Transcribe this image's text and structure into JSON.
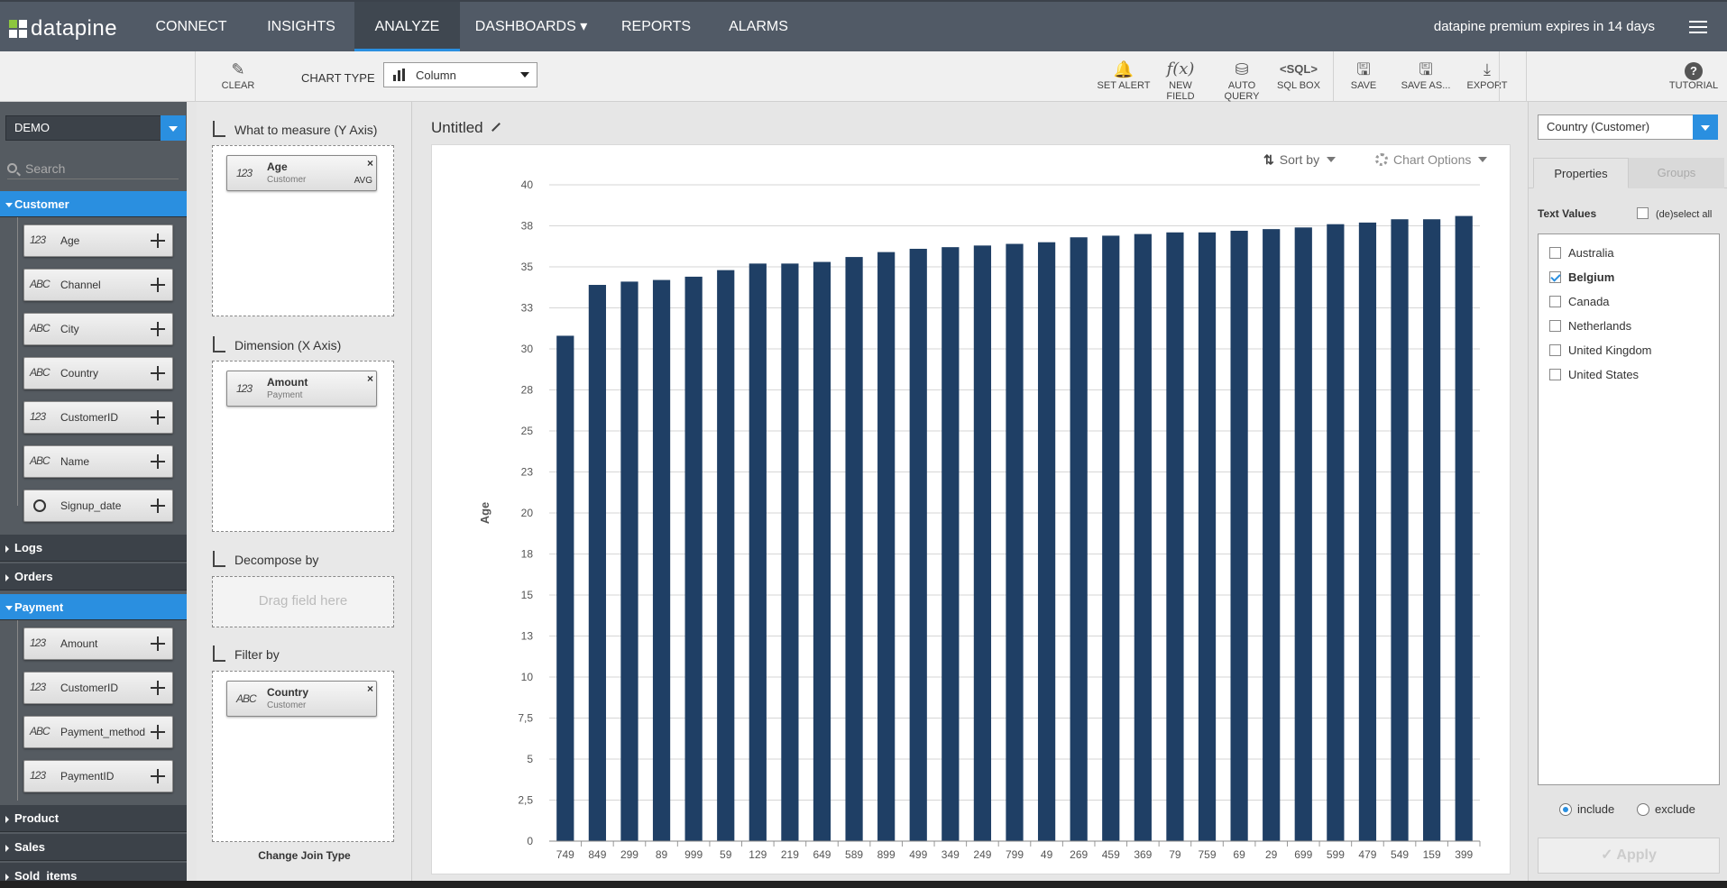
{
  "brand": {
    "name": "datapine"
  },
  "nav": {
    "items": [
      {
        "label": "CONNECT"
      },
      {
        "label": "INSIGHTS"
      },
      {
        "label": "ANALYZE"
      },
      {
        "label": "DASHBOARDS ▾"
      },
      {
        "label": "REPORTS"
      },
      {
        "label": "ALARMS"
      }
    ],
    "active": "ANALYZE",
    "premium_notice": "datapine premium expires in 14 days"
  },
  "toolbar": {
    "clear": "CLEAR",
    "chart_type_label": "CHART TYPE",
    "chart_type_value": "Column",
    "set_alert": "SET ALERT",
    "new_field": "NEW FIELD",
    "auto_query": "AUTO QUERY",
    "sql_box": "SQL BOX",
    "sql_icon_text": "<SQL>",
    "fx_icon_text": "f(x)",
    "save": "SAVE",
    "save_as": "SAVE AS...",
    "export": "EXPORT",
    "tutorial": "TUTORIAL",
    "help_icon_text": "?"
  },
  "sidebar": {
    "datasource": "DEMO",
    "search_placeholder": "Search",
    "tables": [
      {
        "name": "Customer",
        "open": true,
        "fields": [
          {
            "type": "123",
            "name": "Age"
          },
          {
            "type": "ABC",
            "name": "Channel"
          },
          {
            "type": "ABC",
            "name": "City"
          },
          {
            "type": "ABC",
            "name": "Country"
          },
          {
            "type": "123",
            "name": "CustomerID"
          },
          {
            "type": "ABC",
            "name": "Name"
          },
          {
            "type": "date",
            "name": "Signup_date"
          }
        ]
      },
      {
        "name": "Logs",
        "open": false
      },
      {
        "name": "Orders",
        "open": false
      },
      {
        "name": "Payment",
        "open": true,
        "fields": [
          {
            "type": "123",
            "name": "Amount"
          },
          {
            "type": "123",
            "name": "CustomerID"
          },
          {
            "type": "ABC",
            "name": "Payment_method"
          },
          {
            "type": "123",
            "name": "PaymentID"
          }
        ]
      },
      {
        "name": "Product",
        "open": false
      },
      {
        "name": "Sales",
        "open": false
      },
      {
        "name": "Sold_items",
        "open": false
      }
    ]
  },
  "config": {
    "measure_title": "What to measure (Y Axis)",
    "measure_chip": {
      "type": "123",
      "name": "Age",
      "table": "Customer",
      "agg": "AVG"
    },
    "dimension_title": "Dimension (X Axis)",
    "dimension_chip": {
      "type": "123",
      "name": "Amount",
      "table": "Payment"
    },
    "decompose_title": "Decompose by",
    "decompose_hint": "Drag field here",
    "filter_title": "Filter by",
    "filter_chip": {
      "type": "ABC",
      "name": "Country",
      "table": "Customer"
    },
    "join_label": "Change Join Type"
  },
  "chart": {
    "title": "Untitled",
    "sort_label": "Sort by",
    "options_label": "Chart Options"
  },
  "chart_data": {
    "type": "bar",
    "ylabel": "Age",
    "xlabel": "",
    "ylim": [
      0,
      40
    ],
    "yticks": [
      "0",
      "2,5",
      "5",
      "7,5",
      "10",
      "13",
      "15",
      "18",
      "20",
      "23",
      "25",
      "28",
      "30",
      "33",
      "35",
      "38",
      "40"
    ],
    "grid": true,
    "bar_color": "#1f3f65",
    "categories": [
      "749",
      "849",
      "299",
      "89",
      "999",
      "59",
      "129",
      "219",
      "649",
      "589",
      "899",
      "499",
      "349",
      "249",
      "799",
      "49",
      "269",
      "459",
      "369",
      "79",
      "759",
      "69",
      "29",
      "699",
      "599",
      "479",
      "549",
      "159",
      "399"
    ],
    "values": [
      30.8,
      33.9,
      34.1,
      34.2,
      34.4,
      34.8,
      35.2,
      35.2,
      35.3,
      35.6,
      35.9,
      36.1,
      36.2,
      36.3,
      36.4,
      36.5,
      36.8,
      36.9,
      37.0,
      37.1,
      37.1,
      37.2,
      37.3,
      37.4,
      37.6,
      37.7,
      37.9,
      37.9,
      38.1
    ]
  },
  "right_panel": {
    "group_select": "Country (Customer)",
    "tab_properties": "Properties",
    "tab_groups": "Groups",
    "text_values_label": "Text Values",
    "deselect_label": "(de)select all",
    "values": [
      {
        "label": "Australia",
        "checked": false
      },
      {
        "label": "Belgium",
        "checked": true
      },
      {
        "label": "Canada",
        "checked": false
      },
      {
        "label": "Netherlands",
        "checked": false
      },
      {
        "label": "United Kingdom",
        "checked": false
      },
      {
        "label": "United States",
        "checked": false
      }
    ],
    "include_label": "include",
    "exclude_label": "exclude",
    "mode": "include",
    "apply_label": "✓ Apply"
  },
  "colors": {
    "accent": "#2a8fe0",
    "nav_bg": "#515a66",
    "sidebar_bg": "#555b61",
    "bar": "#1f3f65"
  }
}
